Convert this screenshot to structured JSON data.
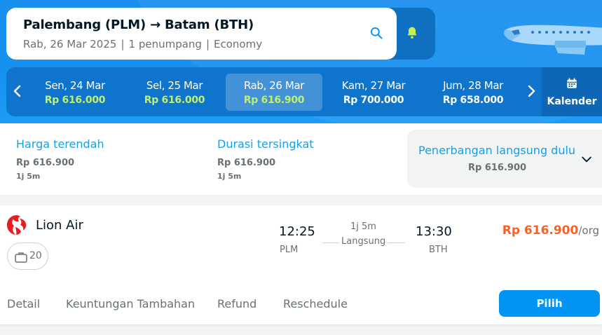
{
  "search": {
    "route": "Palembang (PLM) → Batam (BTH)",
    "date": "Rab, 26 Mar 2025",
    "passengers": "1 penumpang",
    "cabin": "Economy",
    "separator": "|"
  },
  "datebar": {
    "dates": [
      {
        "label": "Sen, 24 Mar",
        "price": "Rp 616.000",
        "lowest": true
      },
      {
        "label": "Sel, 25 Mar",
        "price": "Rp 616.000",
        "lowest": true
      },
      {
        "label": "Rab, 26 Mar",
        "price": "Rp 616.900",
        "lowest": true,
        "selected": true
      },
      {
        "label": "Kam, 27 Mar",
        "price": "Rp 700.000",
        "lowest": false
      },
      {
        "label": "Jum, 28 Mar",
        "price": "Rp 658.000",
        "lowest": false
      }
    ],
    "calendar_label": "Kalender"
  },
  "sort": {
    "options": [
      {
        "title": "Harga terendah",
        "price": "Rp 616.900",
        "duration": "1j 5m"
      },
      {
        "title": "Durasi tersingkat",
        "price": "Rp 616.900",
        "duration": "1j 5m"
      },
      {
        "title": "Penerbangan langsung dulu",
        "price": "Rp 616.900"
      }
    ]
  },
  "flight": {
    "airline": "Lion Air",
    "baggage": "20",
    "departure_time": "12:25",
    "departure_code": "PLM",
    "arrival_time": "13:30",
    "arrival_code": "BTH",
    "duration": "1j 5m",
    "stops": "Langsung",
    "price": "Rp 616.900",
    "price_unit": "/org",
    "tabs": [
      "Detail",
      "Keuntungan Tambahan",
      "Refund",
      "Reschedule"
    ],
    "choose_label": "Pilih"
  },
  "colors": {
    "brand_blue": "#0194f3",
    "header_blue": "#1a8fee",
    "price_orange": "#ff5e1f",
    "lowest_green": "#c0f06a",
    "link_blue": "#1ba0e2"
  },
  "icons": [
    "search-icon",
    "bell-icon",
    "airplane-illustration",
    "chevron-left-icon",
    "chevron-right-icon",
    "calendar-icon",
    "chevron-down-icon",
    "lion-air-logo",
    "baggage-icon"
  ]
}
